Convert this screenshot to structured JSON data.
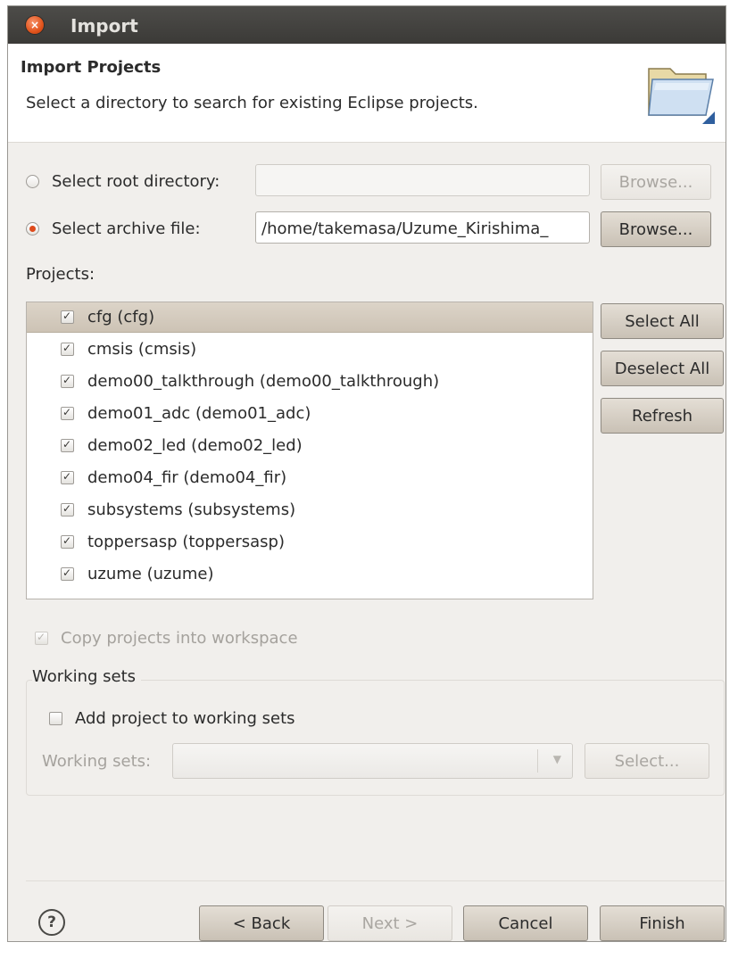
{
  "window": {
    "title": "Import"
  },
  "header": {
    "title": "Import Projects",
    "description": "Select a directory to search for existing Eclipse projects."
  },
  "source": {
    "root_directory": {
      "label": "Select root directory:",
      "value": "",
      "selected": false,
      "browse_label": "Browse..."
    },
    "archive_file": {
      "label": "Select archive file:",
      "value": "/home/takemasa/Uzume_Kirishima_",
      "selected": true,
      "browse_label": "Browse..."
    }
  },
  "projects": {
    "label": "Projects:",
    "items": [
      {
        "label": "cfg (cfg)",
        "checked": true,
        "selected": true
      },
      {
        "label": "cmsis (cmsis)",
        "checked": true
      },
      {
        "label": "demo00_talkthrough (demo00_talkthrough)",
        "checked": true
      },
      {
        "label": "demo01_adc (demo01_adc)",
        "checked": true
      },
      {
        "label": "demo02_led (demo02_led)",
        "checked": true
      },
      {
        "label": "demo04_fir (demo04_fir)",
        "checked": true
      },
      {
        "label": "subsystems (subsystems)",
        "checked": true
      },
      {
        "label": "toppersasp (toppersasp)",
        "checked": true
      },
      {
        "label": "uzume (uzume)",
        "checked": true
      }
    ],
    "select_all_label": "Select All",
    "deselect_all_label": "Deselect All",
    "refresh_label": "Refresh"
  },
  "options": {
    "copy_into_workspace": {
      "label": "Copy projects into workspace",
      "checked": true,
      "enabled": false
    }
  },
  "working_sets": {
    "group_label": "Working sets",
    "add_label": "Add project to working sets",
    "add_checked": false,
    "combo_label": "Working sets:",
    "combo_value": "",
    "select_label": "Select..."
  },
  "footer": {
    "help_glyph": "?",
    "back_label": "< Back",
    "next_label": "Next >",
    "cancel_label": "Cancel",
    "finish_label": "Finish"
  },
  "colors": {
    "accent_radio": "#de4b1c",
    "titlebar": "#3b3a37",
    "dialog_bg": "#f1efec"
  }
}
